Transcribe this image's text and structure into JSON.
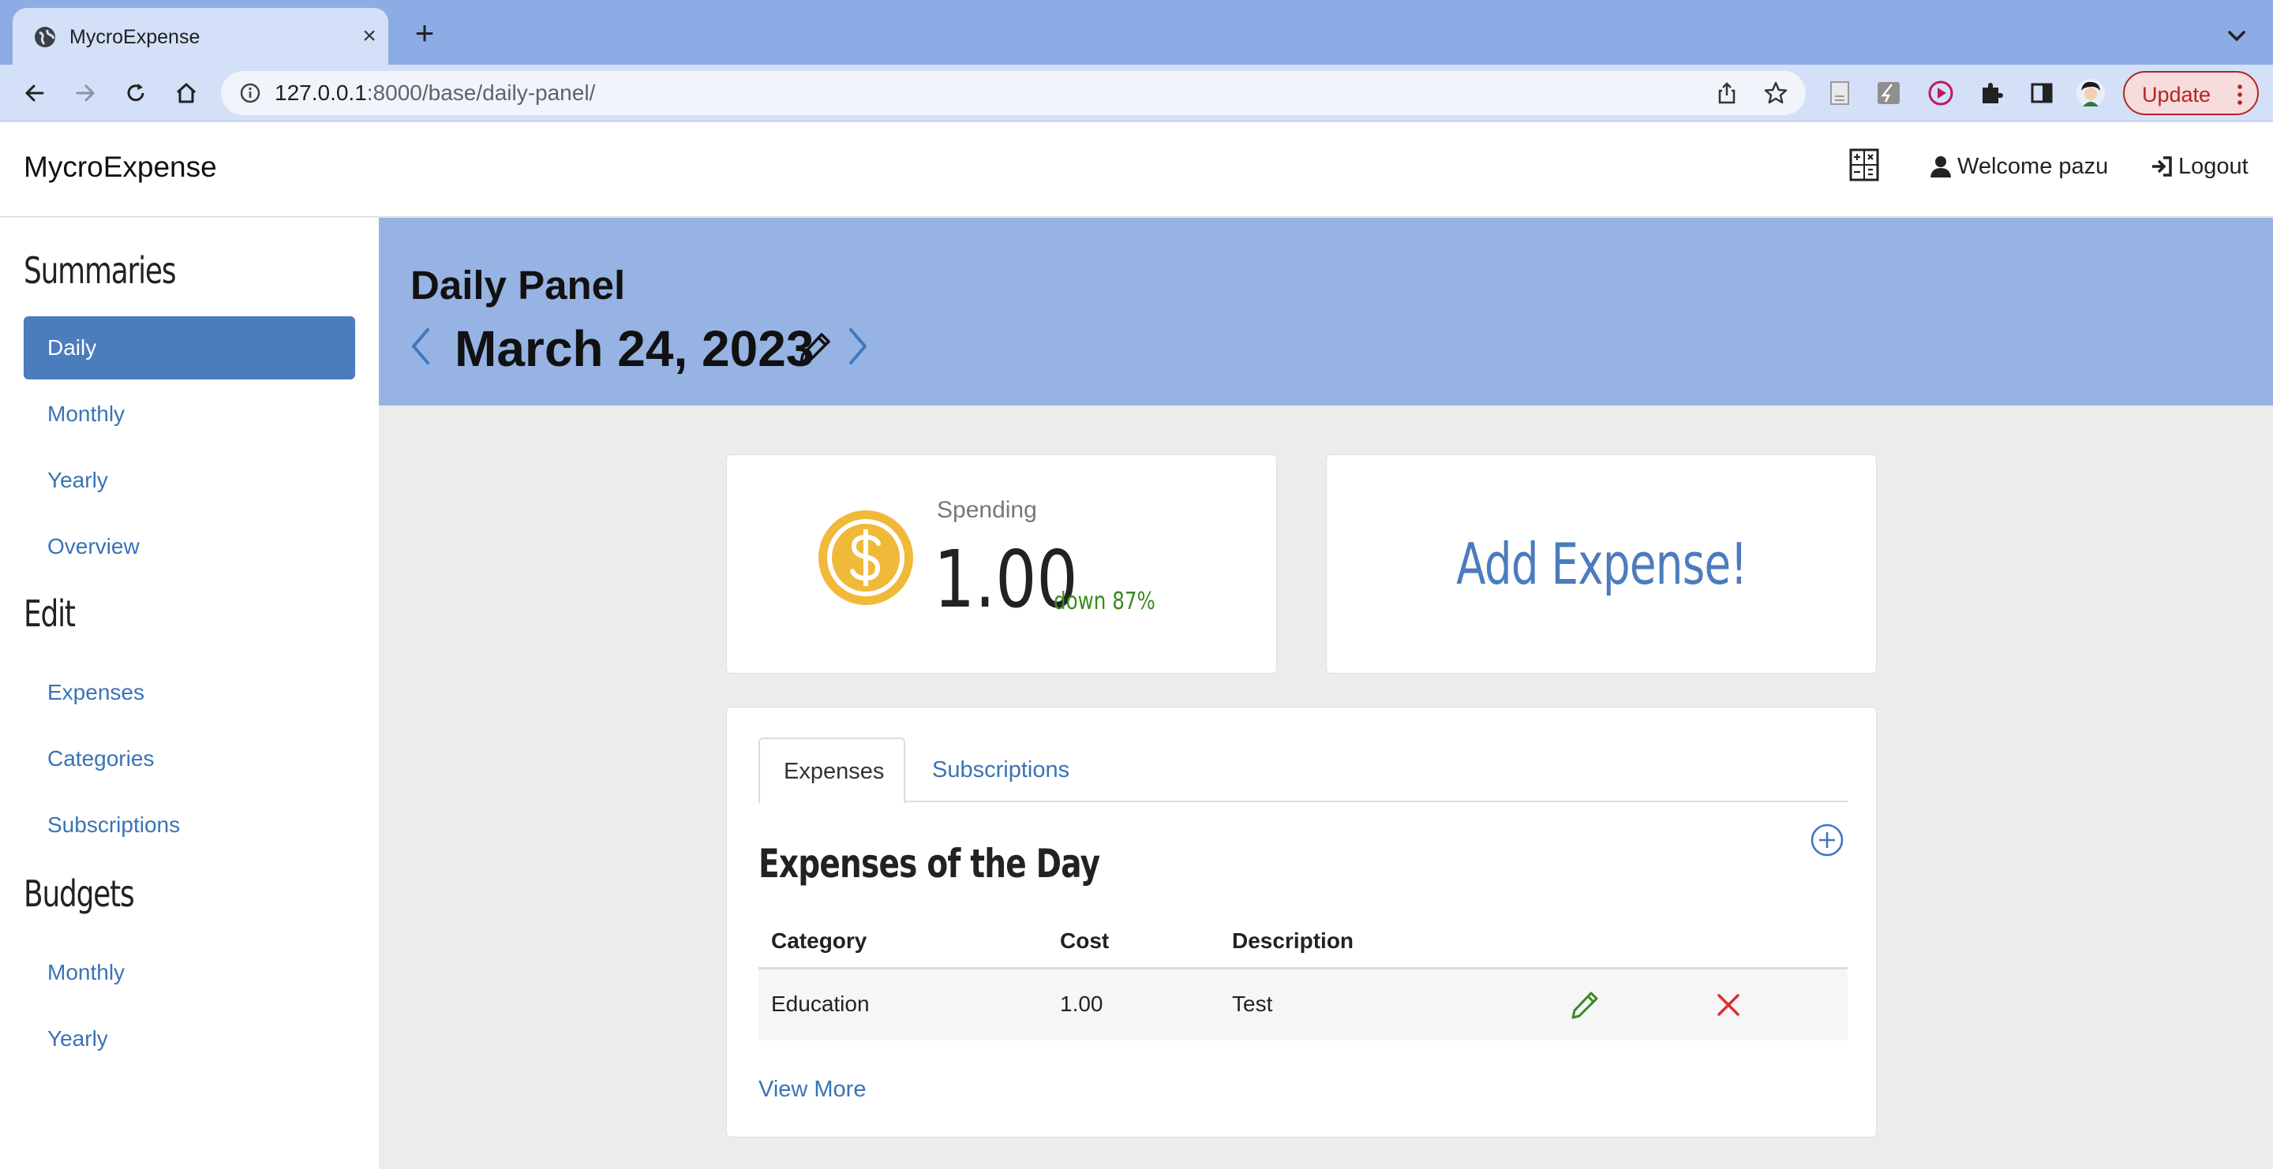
{
  "browser": {
    "tab_title": "MycroExpense",
    "url_host": "127.0.0.1",
    "url_rest": ":8000/base/daily-panel/",
    "update_label": "Update"
  },
  "navbar": {
    "brand": "MycroExpense",
    "welcome": "Welcome pazu",
    "logout": "Logout"
  },
  "sidebar": {
    "summaries_heading": "Summaries",
    "summaries": [
      {
        "label": "Daily",
        "active": true
      },
      {
        "label": "Monthly"
      },
      {
        "label": "Yearly"
      },
      {
        "label": "Overview"
      }
    ],
    "edit_heading": "Edit",
    "edit": [
      {
        "label": "Expenses"
      },
      {
        "label": "Categories"
      },
      {
        "label": "Subscriptions"
      }
    ],
    "budgets_heading": "Budgets",
    "budgets": [
      {
        "label": "Monthly"
      },
      {
        "label": "Yearly"
      }
    ]
  },
  "header": {
    "title": "Daily Panel",
    "date": "March 24, 2023"
  },
  "spending": {
    "label": "Spending",
    "value": "1.00",
    "change": "down 87%"
  },
  "add_expense": {
    "label": "Add Expense!"
  },
  "tabs": [
    {
      "label": "Expenses",
      "active": true
    },
    {
      "label": "Subscriptions"
    }
  ],
  "expenses": {
    "title": "Expenses of the Day",
    "columns": [
      "Category",
      "Cost",
      "Description"
    ],
    "rows": [
      {
        "category": "Education",
        "cost": "1.00",
        "description": "Test"
      }
    ],
    "view_more": "View More"
  },
  "colors": {
    "accent": "#4a7cbe",
    "header_band": "#96b3e3",
    "positive_change": "#3a8a1e",
    "delete": "#d9302c",
    "edit": "#3a8a1e",
    "coin": "#f0b93a"
  }
}
